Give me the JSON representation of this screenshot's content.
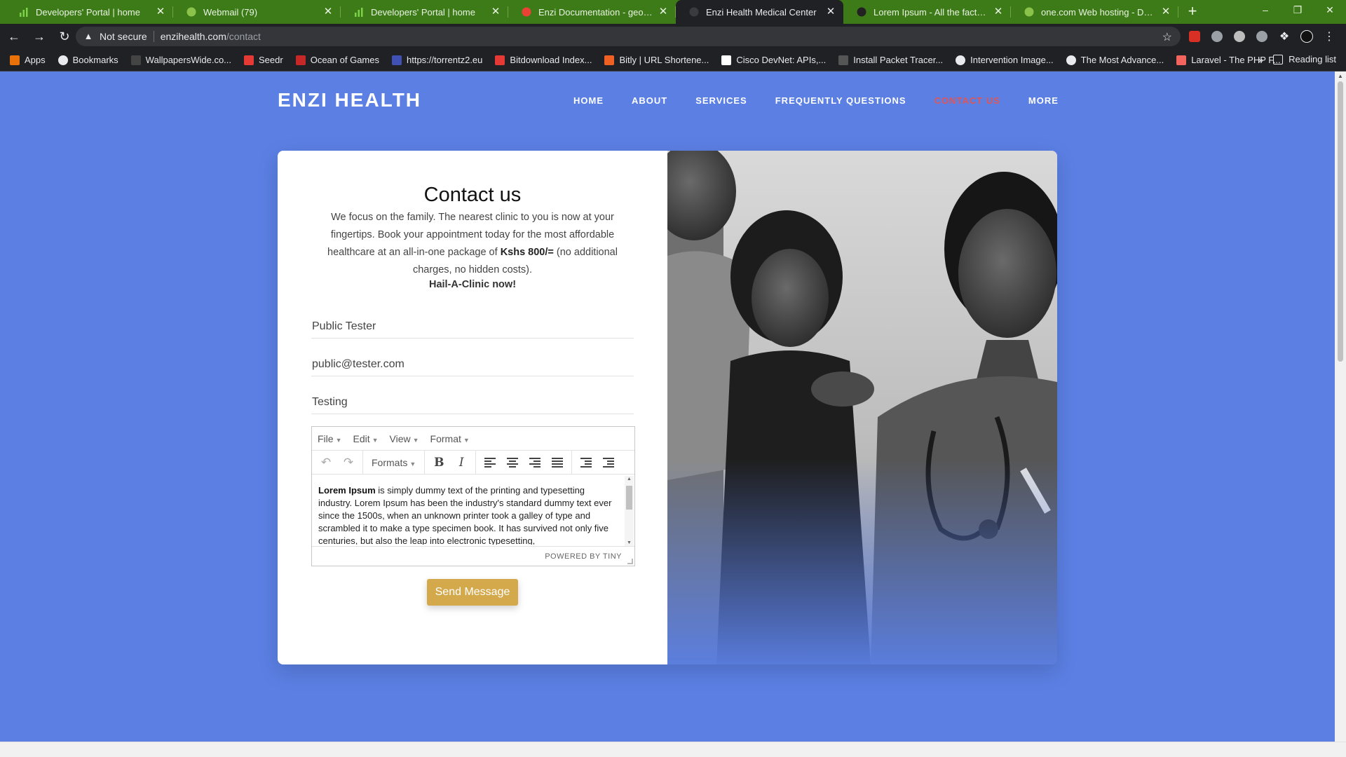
{
  "browser": {
    "tabs": [
      {
        "title": "Developers' Portal | home",
        "icon": "bars-chart-icon",
        "color": "#7cd34a",
        "active": false
      },
      {
        "title": "Webmail (79)",
        "icon": "green-circle-icon",
        "color": "#8bc34a",
        "active": false
      },
      {
        "title": "Developers' Portal | home",
        "icon": "bars-chart-icon",
        "color": "#7cd34a",
        "active": false
      },
      {
        "title": "Enzi Documentation - george.jan",
        "icon": "gmail-icon",
        "color": "#ea4335",
        "active": false
      },
      {
        "title": "Enzi Health Medical Center",
        "icon": "enzi-logo-icon",
        "color": "#3a3b3f",
        "active": true
      },
      {
        "title": "Lorem Ipsum - All the facts - Lips",
        "icon": "lipsum-icon",
        "color": "#222222",
        "active": false
      },
      {
        "title": "one.com Web hosting - Domain",
        "icon": "green-circle-icon",
        "color": "#8bc34a",
        "active": false
      }
    ],
    "new_tab_glyph": "+",
    "address": {
      "security_label": "Not secure",
      "host": "enzihealth.com",
      "path": "/contact"
    },
    "bookmarks": [
      {
        "label": "Apps",
        "icon": "apps-grid-icon",
        "color": "#e8710a"
      },
      {
        "label": "Bookmarks",
        "icon": "star-icon",
        "color": "#e8eaed"
      },
      {
        "label": "WallpapersWide.co...",
        "icon": "wallpaper-icon",
        "color": "#444444"
      },
      {
        "label": "Seedr",
        "icon": "seedr-icon",
        "color": "#e53935"
      },
      {
        "label": "Ocean of Games",
        "icon": "ocean-games-icon",
        "color": "#c62828"
      },
      {
        "label": "https://torrentz2.eu",
        "icon": "torrentz-icon",
        "color": "#3f51b5"
      },
      {
        "label": "Bitdownload Index...",
        "icon": "bitdownload-icon",
        "color": "#e53935"
      },
      {
        "label": "Bitly | URL Shortene...",
        "icon": "bitly-icon",
        "color": "#ee6123"
      },
      {
        "label": "Cisco DevNet: APIs,...",
        "icon": "cisco-icon",
        "color": "#ffffff"
      },
      {
        "label": "Install Packet Tracer...",
        "icon": "packet-tracer-icon",
        "color": "#555555"
      },
      {
        "label": "Intervention Image...",
        "icon": "intervention-icon",
        "color": "#e8eaed"
      },
      {
        "label": "The Most Advance...",
        "icon": "globe-icon",
        "color": "#e8eaed"
      },
      {
        "label": "Laravel - The PHP F...",
        "icon": "laravel-icon",
        "color": "#f4645f"
      }
    ],
    "bookmarks_overflow": "»",
    "reading_list": "Reading list"
  },
  "site": {
    "logo": "ENZI HEALTH",
    "nav": [
      "HOME",
      "ABOUT",
      "SERVICES",
      "FREQUENTLY QUESTIONS",
      "CONTACT US",
      "MORE"
    ],
    "active_nav": "CONTACT US"
  },
  "contact": {
    "title": "Contact us",
    "desc_before": "We focus on the family. The nearest clinic to you is now at your fingertips. Book your appointment today for the most affordable healthcare at an all-in-one package of ",
    "desc_price": "Kshs 800/=",
    "desc_after": " (no additional charges, no hidden costs).",
    "cta": "Hail-A-Clinic now!",
    "name_value": "Public Tester",
    "email_value": "public@tester.com",
    "subject_value": "Testing",
    "send_label": "Send Message"
  },
  "editor": {
    "menus": [
      "File",
      "Edit",
      "View",
      "Format"
    ],
    "formats_label": "Formats",
    "bold_glyph": "B",
    "italic_glyph": "I",
    "body_bold": "Lorem Ipsum",
    "body_text": " is simply dummy text of the printing and typesetting industry. Lorem Ipsum has been the industry's standard dummy text ever since the 1500s, when an unknown printer took a galley of type and scrambled it to make a type specimen book. It has survived not only five centuries, but also the leap into electronic typesetting,",
    "powered_by": "POWERED BY TINY"
  },
  "colors": {
    "page_bg": "#5b7fe3",
    "active_nav": "#e25555",
    "send_button": "#d4a94b",
    "tab_strip": "#3d7b18"
  }
}
